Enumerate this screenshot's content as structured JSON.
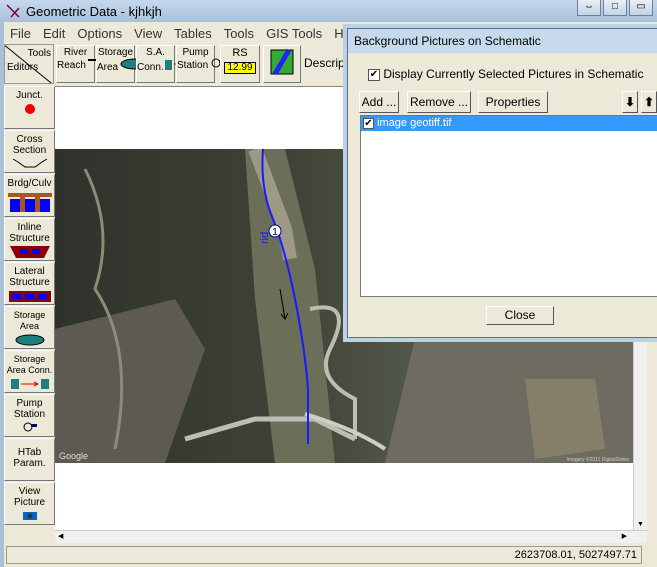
{
  "window": {
    "title": "Geometric Data - kjhkjh",
    "buttons": [
      "⇔",
      "□",
      "▭"
    ]
  },
  "menu": [
    "File",
    "Edit",
    "Options",
    "View",
    "Tables",
    "Tools",
    "GIS Tools",
    "Help"
  ],
  "toolbar": {
    "corner_tools": "Tools",
    "corner_editors": "Editors",
    "river_reach": "River\nReach",
    "storage_area": "Storage\nArea",
    "sa_conn": "S.A.\nConn.",
    "pump_station": "Pump\nStation",
    "rs": "RS",
    "rs_value": "12.99",
    "description": "Description"
  },
  "editors": [
    {
      "label": "Junct."
    },
    {
      "label": "Cross Section"
    },
    {
      "label": "Brdg/Culv"
    },
    {
      "label": "Inline Structure"
    },
    {
      "label": "Lateral Structure"
    },
    {
      "label": "Storage Area"
    },
    {
      "label": "Storage Area Conn."
    },
    {
      "label": "Pump Station"
    },
    {
      "label": "HTab Param."
    },
    {
      "label": "View Picture"
    }
  ],
  "map": {
    "river_label": "rid",
    "junction_label": "1",
    "watermark": "Google",
    "copyright": "Imagery ©2011 DigitalGlobe"
  },
  "status": {
    "coordinates": "2623708.01, 5027497.71"
  },
  "dialog": {
    "title": "Background Pictures on Schematic",
    "display_checkbox": "Display Currently Selected Pictures in Schematic",
    "display_checked": true,
    "add": "Add ...",
    "remove": "Remove ...",
    "properties": "Properties ...",
    "down": "⬇",
    "up": "⬆",
    "pictures": [
      {
        "name": "image geotiff.tif",
        "checked": true
      }
    ],
    "close": "Close"
  },
  "colors": {
    "river": "#1a1aff",
    "selection": "#3399ff",
    "storage": "#1f7f7f"
  }
}
